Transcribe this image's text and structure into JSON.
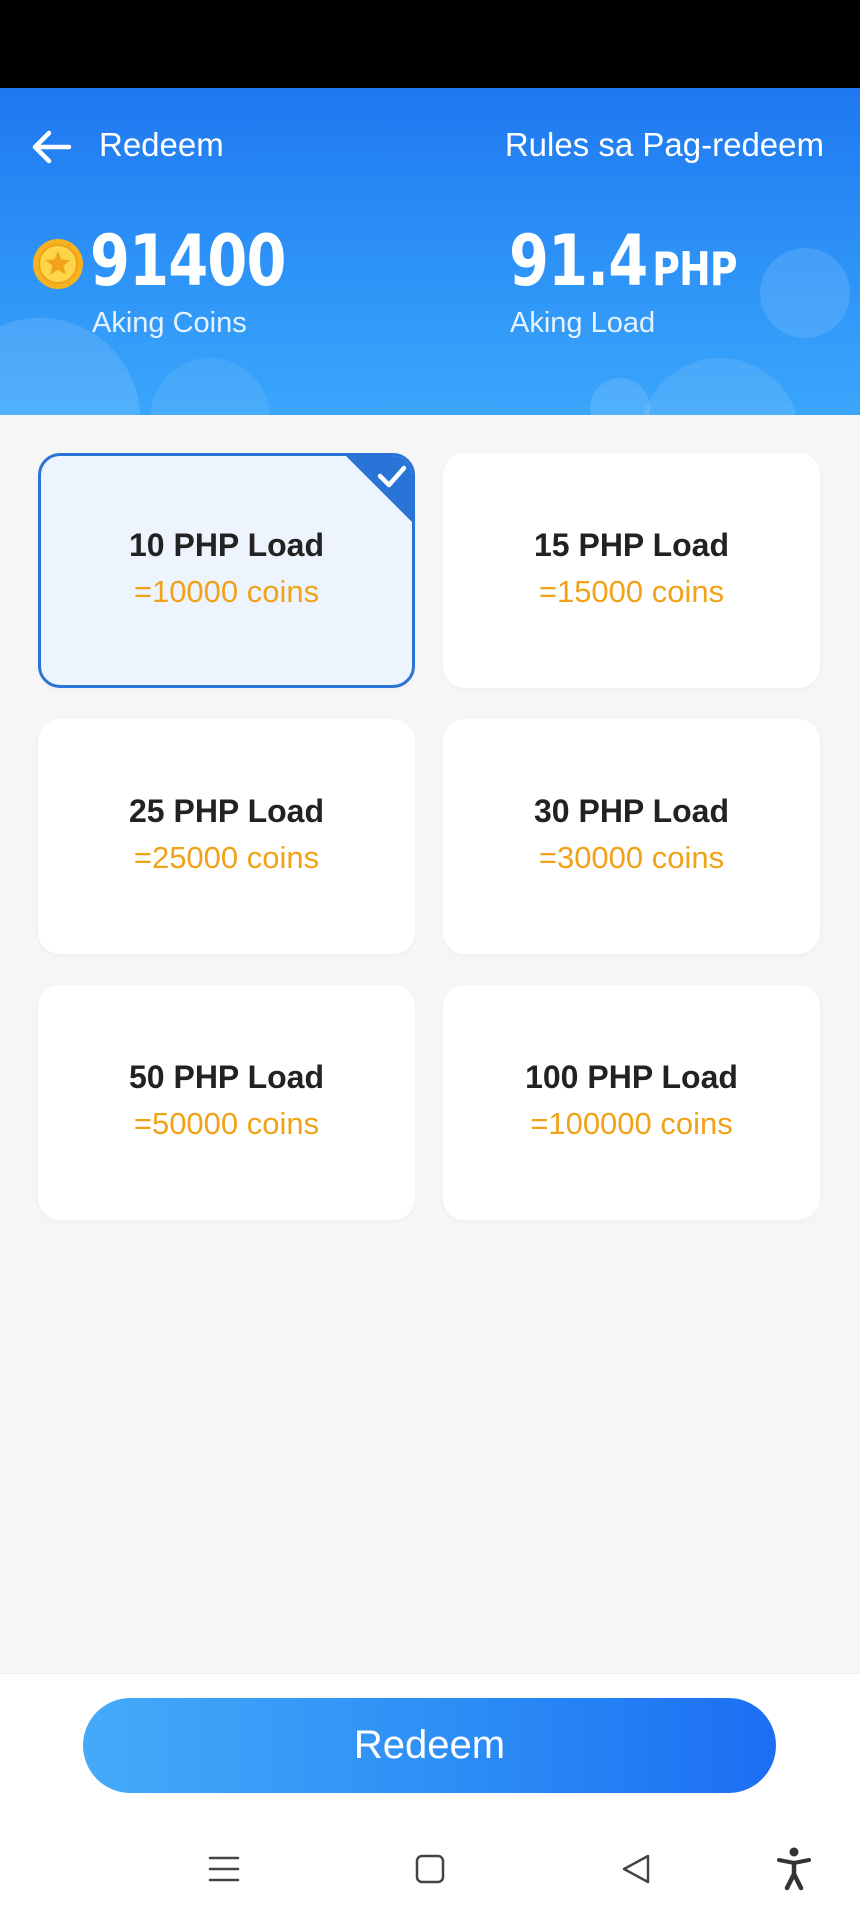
{
  "header": {
    "title": "Redeem",
    "rules_link": "Rules sa Pag-redeem",
    "coins_value": "91400",
    "coins_label": "Aking Coins",
    "load_value": "91.4",
    "load_unit": "PHP",
    "load_label": "Aking Load"
  },
  "options": [
    {
      "title": "10 PHP Load",
      "cost": "=10000 coins",
      "selected": true
    },
    {
      "title": "15 PHP Load",
      "cost": "=15000 coins",
      "selected": false
    },
    {
      "title": "25 PHP Load",
      "cost": "=25000 coins",
      "selected": false
    },
    {
      "title": "30 PHP Load",
      "cost": "=30000 coins",
      "selected": false
    },
    {
      "title": "50 PHP Load",
      "cost": "=50000 coins",
      "selected": false
    },
    {
      "title": "100 PHP Load",
      "cost": "=100000 coins",
      "selected": false
    }
  ],
  "footer": {
    "redeem_label": "Redeem"
  },
  "colors": {
    "accent": "#2a74d8",
    "coin_text": "#f0a21a",
    "header_gradient_top": "#1f78f0",
    "header_gradient_bottom": "#3aa6fb"
  },
  "icons": {
    "back": "arrow-left-icon",
    "coin": "coin-icon",
    "check": "check-icon",
    "nav_menu": "menu-icon",
    "nav_home": "home-icon",
    "nav_back": "triangle-back-icon",
    "nav_accessibility": "accessibility-icon"
  }
}
